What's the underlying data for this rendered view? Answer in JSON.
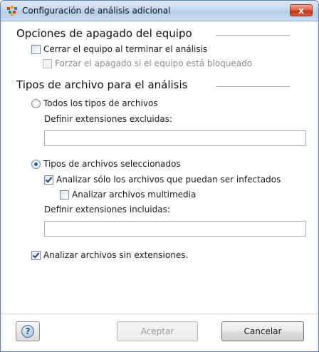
{
  "window": {
    "title": "Configuración de análisis adicional",
    "close_label": "x"
  },
  "shutdown": {
    "heading": "Opciones de apagado del equipo",
    "shutdown_on_finish": {
      "label": "Cerrar el equipo al terminar el análisis",
      "checked": false
    },
    "force_if_locked": {
      "label": "Forzar el apagado si el equipo está bloqueado",
      "checked": false,
      "disabled": true
    }
  },
  "file_types": {
    "heading": "Tipos de archivo para el análisis",
    "all_types": {
      "label": "Todos los tipos de archivos",
      "selected": false
    },
    "excluded_label": "Definir extensiones excluidas:",
    "excluded_value": "",
    "selected_types": {
      "label": "Tipos de archivos seleccionados",
      "selected": true
    },
    "infectable_only": {
      "label": "Analizar sólo los archivos que puedan ser infectados",
      "checked": true
    },
    "multimedia": {
      "label": "Analizar archivos multimedia",
      "checked": false
    },
    "included_label": "Definir extensiones incluidas:",
    "included_value": "",
    "no_extensions": {
      "label": "Analizar archivos sin extensiones.",
      "checked": true
    }
  },
  "footer": {
    "help_label": "?",
    "accept_label": "Aceptar",
    "cancel_label": "Cancelar"
  },
  "colors": {
    "accent": "#2b58b5",
    "title_bar": "#c5d9ee",
    "close_button": "#d9573b"
  }
}
